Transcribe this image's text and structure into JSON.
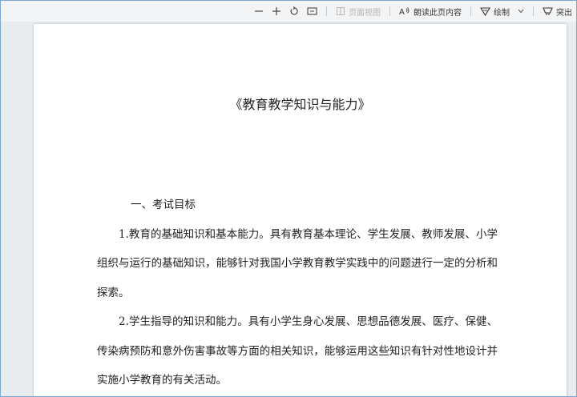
{
  "toolbar": {
    "zoom_out_icon": "minus-icon",
    "zoom_in_icon": "plus-icon",
    "rotate_icon": "rotate-icon",
    "fit_icon": "fit-page-icon",
    "page_view_label": "页面视图",
    "read_aloud_label": "朗读此页内容",
    "draw_label": "绘制",
    "highlight_label": "突出"
  },
  "document": {
    "title": "《教育教学知识与能力》",
    "paragraphs": [
      "一、考试目标",
      "1.教育的基础知识和基本能力。具有教育基本理论、学生发展、教师发展、小学组织与运行的基础知识，能够针对我国小学教育教学实践中的问题进行一定的分析和探索。",
      "2.学生指导的知识和能力。具有小学生身心发展、思想品德发展、医疗、保健、传染病预防和意外伤害事故等方面的相关知识，能够运用这些知识有针对性地设计并实施小学教育的有关活动。"
    ]
  }
}
